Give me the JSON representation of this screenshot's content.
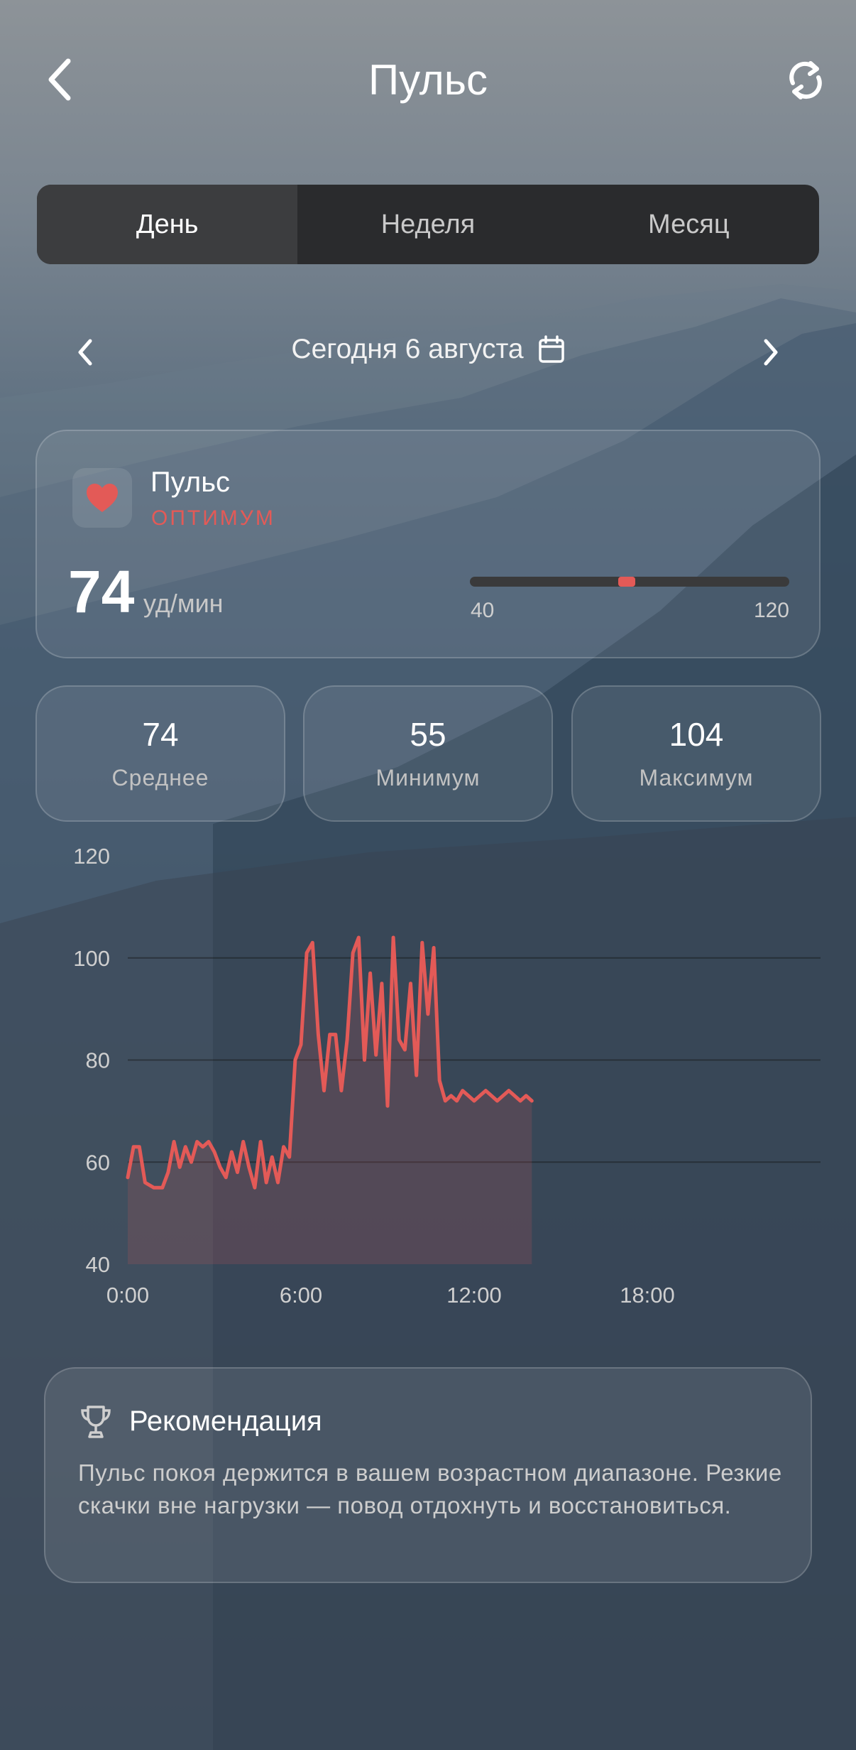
{
  "header": {
    "title": "Пульс",
    "back_icon": "chevron-left-icon",
    "refresh_icon": "refresh-icon"
  },
  "tabs": [
    {
      "label": "День",
      "active": true
    },
    {
      "label": "Неделя",
      "active": false
    },
    {
      "label": "Месяц",
      "active": false
    }
  ],
  "date_nav": {
    "label": "Сегодня 6 августа",
    "calendar_icon": "calendar-icon",
    "prev_icon": "chevron-left-icon",
    "next_icon": "chevron-right-icon"
  },
  "pulse_card": {
    "title": "Пульс",
    "status": "ОПТИМУМ",
    "value": "74",
    "unit": "уд/мин",
    "range_min": "40",
    "range_max": "120",
    "icon": "heart-icon"
  },
  "stats": [
    {
      "value": "74",
      "label": "Среднее"
    },
    {
      "value": "55",
      "label": "Минимум"
    },
    {
      "value": "104",
      "label": "Максимум"
    }
  ],
  "chart_data": {
    "type": "area",
    "ylim": [
      40,
      120
    ],
    "yticks": [
      40,
      60,
      80,
      100,
      120
    ],
    "xlim": [
      0,
      24
    ],
    "xticks": [
      {
        "value": 0,
        "label": "0:00"
      },
      {
        "value": 6,
        "label": "6:00"
      },
      {
        "value": 12,
        "label": "12:00"
      },
      {
        "value": 18,
        "label": "18:00"
      }
    ],
    "grid": true,
    "line_color": "#e35a57",
    "x": [
      0.0,
      0.2,
      0.4,
      0.6,
      0.9,
      1.2,
      1.4,
      1.6,
      1.8,
      2.0,
      2.2,
      2.4,
      2.6,
      2.8,
      3.0,
      3.2,
      3.4,
      3.6,
      3.8,
      4.0,
      4.2,
      4.4,
      4.6,
      4.8,
      5.0,
      5.2,
      5.4,
      5.6,
      5.8,
      6.0,
      6.2,
      6.4,
      6.6,
      6.8,
      7.0,
      7.2,
      7.4,
      7.6,
      7.8,
      8.0,
      8.2,
      8.4,
      8.6,
      8.8,
      9.0,
      9.2,
      9.4,
      9.6,
      9.8,
      10.0,
      10.2,
      10.4,
      10.6,
      10.8,
      11.0,
      11.2,
      11.4,
      11.6,
      11.8,
      12.0,
      12.2,
      12.4,
      12.6,
      12.8,
      13.0,
      13.2,
      13.4,
      13.6,
      13.8,
      14.0
    ],
    "y": [
      57,
      63,
      63,
      56,
      55,
      55,
      58,
      64,
      59,
      63,
      60,
      64,
      63,
      64,
      62,
      59,
      57,
      62,
      58,
      64,
      59,
      55,
      64,
      56,
      61,
      56,
      63,
      61,
      80,
      83,
      101,
      103,
      85,
      74,
      85,
      85,
      74,
      84,
      101,
      104,
      80,
      97,
      81,
      95,
      71,
      104,
      84,
      82,
      95,
      77,
      103,
      89,
      102,
      76,
      72,
      73,
      72,
      74,
      73,
      72,
      73,
      74,
      73,
      72,
      73,
      74,
      73,
      72,
      73,
      72
    ]
  },
  "recommendation": {
    "title": "Рекомендация",
    "icon": "trophy-icon",
    "text": "Пульс покоя держится в вашем возрастном диапазоне. Резкие скачки вне нагрузки — повод отдохнуть и восстановиться."
  }
}
